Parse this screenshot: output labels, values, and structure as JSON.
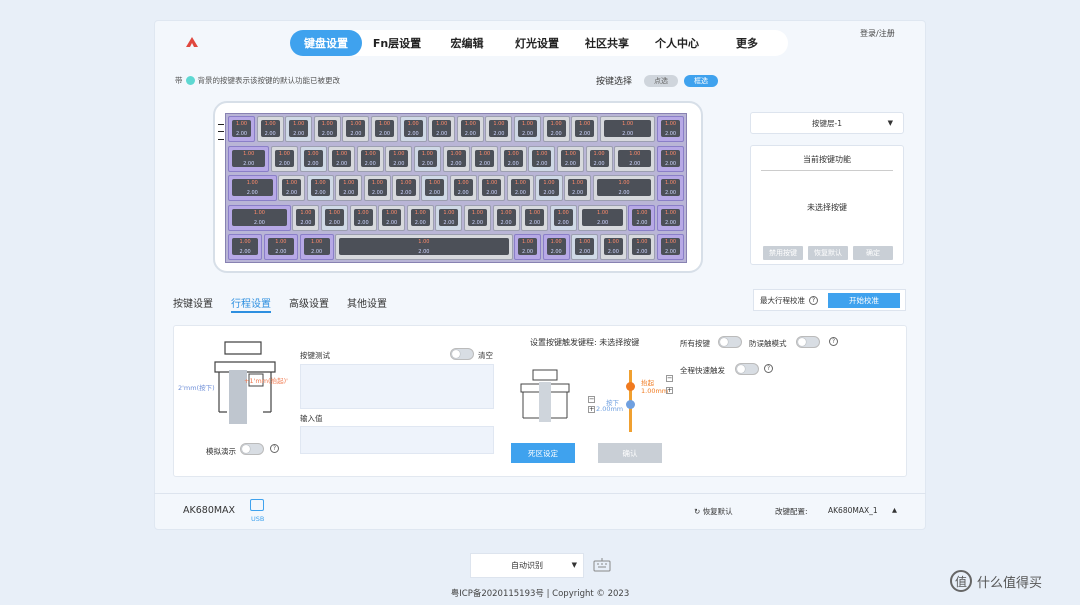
{
  "header": {
    "nav": [
      {
        "label": "键盘设置",
        "active": true
      },
      {
        "label": "Fn层设置"
      },
      {
        "label": "宏编辑"
      },
      {
        "label": "灯光设置"
      },
      {
        "label": "社区共享"
      },
      {
        "label": "个人中心"
      },
      {
        "label": "更多"
      }
    ],
    "login": "登录/注册"
  },
  "toolbar": {
    "hint": "带",
    "hint_rest": "背景的按键表示该按键的默认功能已被更改",
    "select_label": "按键选择",
    "btn_single": "点选",
    "btn_box": "框选"
  },
  "keyboard": {
    "value_top": "1.00",
    "value_bottom": "2.00"
  },
  "right_panel": {
    "layer": "按键层-1",
    "func_title": "当前按键功能",
    "func_empty": "未选择按键",
    "btn_disable": "禁用按键",
    "btn_restore": "恢复默认",
    "btn_ok": "确定"
  },
  "subtabs": [
    "按键设置",
    "行程设置",
    "高级设置",
    "其他设置"
  ],
  "calibration": {
    "label": "最大行程校准",
    "button": "开始校准"
  },
  "stroke": {
    "left_note_1": "2'mm(按下)",
    "left_note_2": "+1'mm(抬起)'",
    "simulate": "模拟演示",
    "key_test": "按键测试",
    "clear": "清空",
    "input_value": "输入值",
    "trigger_title": "设置按键触发键程: 未选择按键",
    "lift_label": "抬起",
    "lift_value": "1.00mm",
    "press_label": "按下",
    "press_value": "2.00mm",
    "deadzone_btn": "死区设定",
    "confirm_btn": "确认",
    "all_keys": "所有按键",
    "anti_mistouch": "防误触模式",
    "rapid_trigger": "全程快速触发"
  },
  "footer": {
    "model": "AK680MAX",
    "usb": "USB",
    "restore": "恢复默认",
    "config_label": "改键配置:",
    "config_value": "AK680MAX_1"
  },
  "bottom": {
    "auto_detect": "自动识别",
    "icp": "粤ICP备2020115193号 | Copyright © 2023",
    "watermark": "什么值得买"
  },
  "colors": {
    "accent": "#3fa2ee",
    "keyboard_purple": "#b7a9e6"
  }
}
